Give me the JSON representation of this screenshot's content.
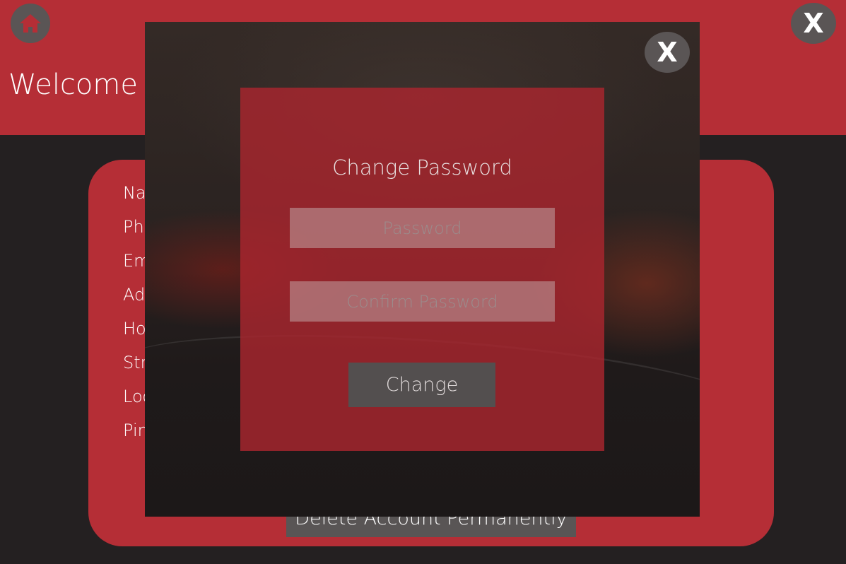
{
  "header": {
    "welcome_text": "Welcome J",
    "home_icon": "home-icon",
    "close_label": "X"
  },
  "profile": {
    "fields": [
      "Na",
      "Ph",
      "Em",
      "Ad",
      "Ho",
      "Str",
      "Loc",
      "Pin"
    ],
    "delete_label": "Delete Account Permanently"
  },
  "modal": {
    "close_label": "X",
    "title": "Change Password",
    "password_placeholder": "Password",
    "confirm_placeholder": "Confirm Password",
    "change_label": "Change"
  },
  "colors": {
    "header_red": "#b52e36",
    "background_dark": "#242021",
    "button_gray": "#595555",
    "dialog_red": "#aa262e"
  }
}
